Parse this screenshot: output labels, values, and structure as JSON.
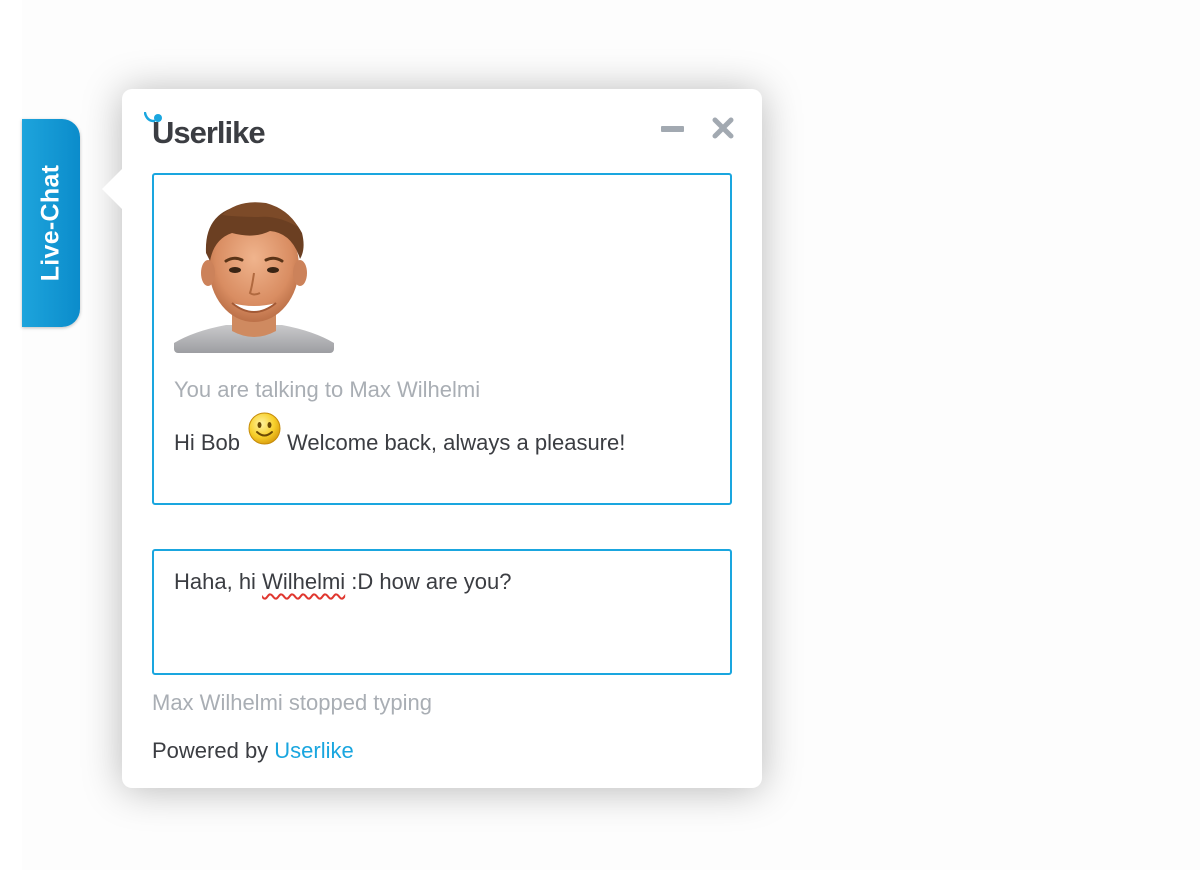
{
  "tab": {
    "label": "Live-Chat"
  },
  "header": {
    "logo_text": "Userlike",
    "minimize_icon": "minimize-icon",
    "close_icon": "close-icon"
  },
  "conversation": {
    "operator_name": "Max Wilhelmi",
    "talking_to": "You are talking to Max Wilhelmi",
    "message_before_emoji": "Hi Bob",
    "emoji": "smiley-icon",
    "message_after_emoji": "Welcome back, always a pleasure!"
  },
  "input": {
    "value_before": "Haha, hi ",
    "value_misspelled": "Wilhelmi",
    "value_after": " :D how are you?"
  },
  "status": {
    "typing": "Max Wilhelmi stopped typing"
  },
  "footer": {
    "powered_prefix": "Powered by ",
    "powered_link": "Userlike"
  },
  "colors": {
    "accent": "#1aa6df",
    "tab": "#0b8ccb",
    "text": "#3b3d42",
    "muted": "#a9aeb4",
    "control": "#a2a9b1",
    "spellcheck": "#e0372f"
  }
}
